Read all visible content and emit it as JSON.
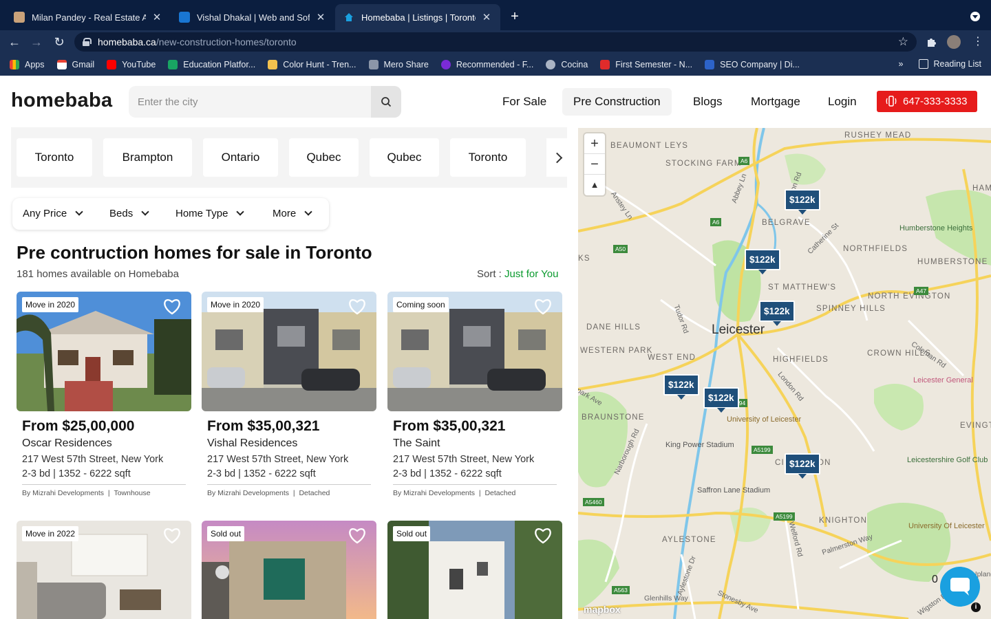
{
  "browser": {
    "tabs": [
      {
        "title": "Milan Pandey - Real Estate Age",
        "active": false
      },
      {
        "title": "Vishal Dhakal | Web and Softw",
        "active": false
      },
      {
        "title": "Homebaba | Listings | Toronto",
        "active": true
      }
    ],
    "url_host": "homebaba.ca",
    "url_path": "/new-construction-homes/toronto",
    "bookmarks": [
      "Apps",
      "Gmail",
      "YouTube",
      "Education Platfor...",
      "Color Hunt - Tren...",
      "Mero Share",
      "Recommended - F...",
      "Cocina",
      "First Semester - N...",
      "SEO Company | Di..."
    ],
    "overflow": "»",
    "reading_list": "Reading List"
  },
  "header": {
    "logo": "homebaba",
    "search_placeholder": "Enter the city",
    "nav": [
      "For Sale",
      "Pre Construction",
      "Blogs",
      "Mortgage",
      "Login"
    ],
    "active_nav": "Pre Construction",
    "phone": "647-333-3333",
    "phone_color": "#e61b1b"
  },
  "cities": [
    "Toronto",
    "Brampton",
    "Ontario",
    "Qubec",
    "Qubec",
    "Toronto"
  ],
  "filters": [
    "Any Price",
    "Beds",
    "Home Type",
    "More"
  ],
  "listing_header": {
    "title": "Pre contruction homes for sale in Toronto",
    "count": "181 homes available on Homebaba",
    "sort_label": "Sort :",
    "sort_value": "Just for You",
    "sort_color": "#0a9a2e"
  },
  "listings": [
    {
      "badge": "Move in 2020",
      "price": "From $25,00,000",
      "name": "Oscar Residences",
      "address": "217 West 57th Street, New York",
      "specs": "2-3 bd | 1352 - 6222 sqft",
      "developer": "By Mizrahi Developments",
      "type": "Townhouse"
    },
    {
      "badge": "Move in 2020",
      "price": "From $35,00,321",
      "name": "Vishal Residences",
      "address": "217 West 57th Street, New York",
      "specs": "2-3 bd | 1352 - 6222 sqft",
      "developer": "By Mizrahi Developments",
      "type": "Detached"
    },
    {
      "badge": "Coming soon",
      "price": "From $35,00,321",
      "name": "The Saint",
      "address": "217 West 57th Street, New York",
      "specs": "2-3 bd | 1352 - 6222 sqft",
      "developer": "By Mizrahi Developments",
      "type": "Detached"
    },
    {
      "badge": "Move in 2022"
    },
    {
      "badge": "Sold out"
    },
    {
      "badge": "Sold out"
    }
  ],
  "map": {
    "pins": [
      "$122k",
      "$122k",
      "$122k",
      "$122k",
      "$122k",
      "$122k"
    ],
    "pin_color": "#1f4f7a",
    "city_label": "Leicester",
    "labels": [
      "BEAUMONT LEYS",
      "STOCKING FARM",
      "RUSHEY MEAD",
      "BELGRAVE",
      "NORTHFIELDS",
      "HUMBERSTONE",
      "ST MATTHEW'S",
      "SPINNEY HILLS",
      "NORTH EVINGTON",
      "DANE HILLS",
      "WESTERN PARK",
      "WEST END",
      "HIGHFIELDS",
      "CROWN HILLS",
      "BRAUNSTONE",
      "KNIGHTON",
      "AYLESTONE",
      "EVINGT",
      "HAM",
      "KS",
      "CI",
      "ON"
    ],
    "pois": [
      "Humberstone Heights",
      "Leicester General",
      "University of Leicester",
      "King Power Stadium",
      "Saffron Lane Stadium",
      "Leicestershire Golf Club",
      "University Of Leicester"
    ],
    "roads": [
      "Abbey Ln",
      "Anstey Ln",
      "Catherine St",
      "Tudor Rd",
      "London Rd",
      "Coleman Rd",
      "Narborough Rd",
      "Welford Rd",
      "Aylestone Dr",
      "Palmerston Way",
      "Stonesby Ave",
      "Glenhills Way",
      "Wigston Rd",
      "Upland",
      "park Ave",
      "on Rd"
    ],
    "road_refs": [
      "A6",
      "A6",
      "A50",
      "A47",
      "A5199",
      "A5199",
      "A5460",
      "A563",
      "594"
    ],
    "attribution": "mapbox",
    "edge_digit": "0"
  }
}
